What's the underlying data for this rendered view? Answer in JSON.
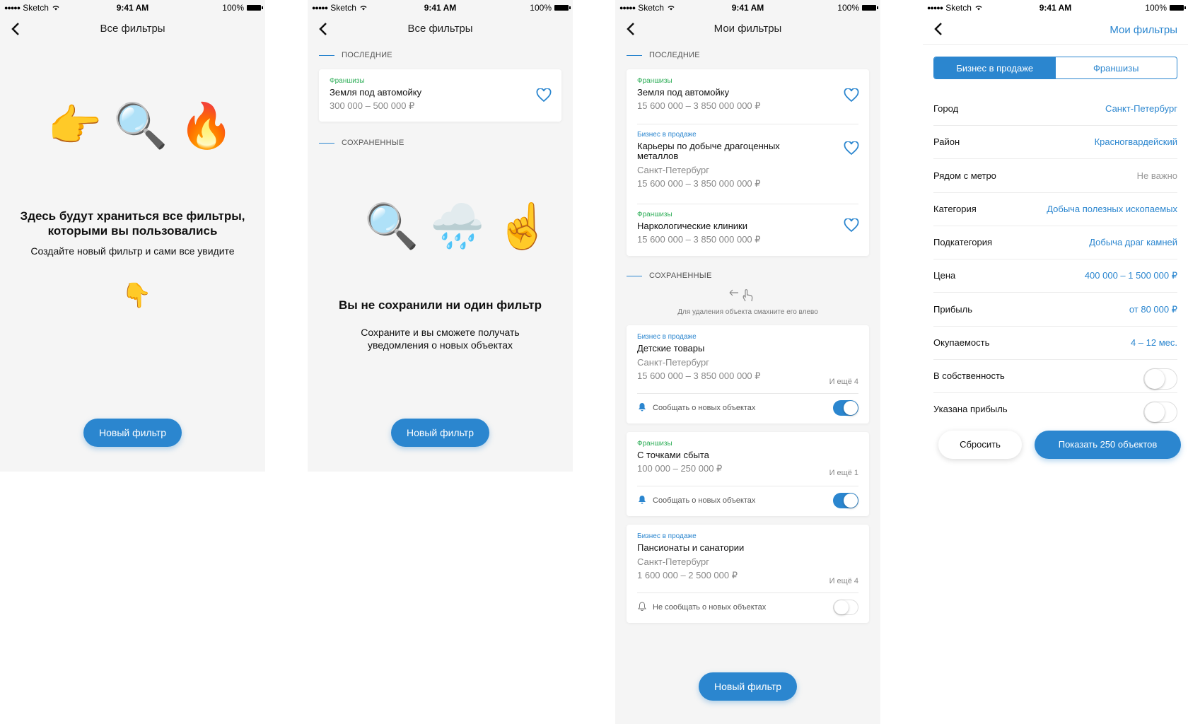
{
  "status": {
    "carrier": "Sketch",
    "time": "9:41 AM",
    "battery": "100%"
  },
  "screen1": {
    "title": "Все фильтры",
    "emoji": [
      "👉",
      "🔍",
      "🔥"
    ],
    "headline": "Здесь будут храниться все фильтры, которыми вы пользовались",
    "sub": "Создайте новый фильтр и сами все увидите",
    "pointer": "👇",
    "button": "Новый фильтр"
  },
  "screen2": {
    "title": "Все фильтры",
    "recent_label": "ПОСЛЕДНИЕ",
    "recent": {
      "category": "Франшизы",
      "title": "Земля под автомойку",
      "price": "300 000 – 500 000 ₽"
    },
    "saved_label": "СОХРАНЕННЫЕ",
    "emoji": [
      "🔍",
      "🌧️",
      "☝️"
    ],
    "headline": "Вы не сохранили ни один фильтр",
    "sub": "Сохраните и вы сможете получать уведомления о новых объектах",
    "button": "Новый фильтр"
  },
  "screen3": {
    "title": "Мои фильтры",
    "recent_label": "ПОСЛЕДНИЕ",
    "recent": [
      {
        "category": "Франшизы",
        "title": "Земля под автомойку",
        "price": "15 600 000 – 3 850 000 000 ₽"
      },
      {
        "category": "Бизнес в продаже",
        "title": "Карьеры по добыче драгоценных металлов",
        "city": "Санкт-Петербург",
        "price": "15 600 000 – 3 850 000 000 ₽"
      },
      {
        "category": "Франшизы",
        "title": "Наркологические клиники",
        "price": "15 600 000 – 3 850 000 000 ₽"
      }
    ],
    "saved_label": "СОХРАНЕННЫЕ",
    "swipe_hint": "Для удаления объекта смахните его влево",
    "saved": [
      {
        "category": "Бизнес в продаже",
        "title": "Детские товары",
        "city": "Санкт-Петербург",
        "price": "15 600 000 – 3 850 000 000 ₽",
        "more": "И ещё 4",
        "notify": "Сообщать о новых объектах",
        "on": true
      },
      {
        "category": "Франшизы",
        "title": "С точками сбыта",
        "price": "100 000 – 250 000 ₽",
        "more": "И ещё 1",
        "notify": "Сообщать о новых объектах",
        "on": true
      },
      {
        "category": "Бизнес в продаже",
        "title": "Пансионаты и санатории",
        "city": "Санкт-Петербург",
        "price": "1 600 000 – 2 500 000 ₽",
        "more": "И ещё 4",
        "notify": "Не сообщать о новых объектах",
        "on": false
      }
    ],
    "button": "Новый фильтр"
  },
  "screen4": {
    "title": "Мои фильтры",
    "tabs": [
      "Бизнес в продаже",
      "Франшизы"
    ],
    "rows": [
      {
        "label": "Город",
        "value": "Санкт-Петербург"
      },
      {
        "label": "Район",
        "value": "Красногвардейский"
      },
      {
        "label": "Рядом с метро",
        "value": "Не важно"
      },
      {
        "label": "Категория",
        "value": "Добыча полезных ископаемых"
      },
      {
        "label": "Подкатегория",
        "value": "Добыча драг камней"
      },
      {
        "label": "Цена",
        "value": "400 000 – 1 500 000 ₽"
      },
      {
        "label": "Прибыль",
        "value": "от 80 000 ₽"
      },
      {
        "label": "Окупаемость",
        "value": "4 – 12 мес."
      },
      {
        "label": "В собственность",
        "toggle": false
      },
      {
        "label": "Указана прибыль",
        "toggle": false
      }
    ],
    "reset": "Сбросить",
    "show": "Показать 250 объектов"
  },
  "colors": {
    "accent": "#2b86cf",
    "green": "#2fae58",
    "bg": "#f5f5f5"
  }
}
